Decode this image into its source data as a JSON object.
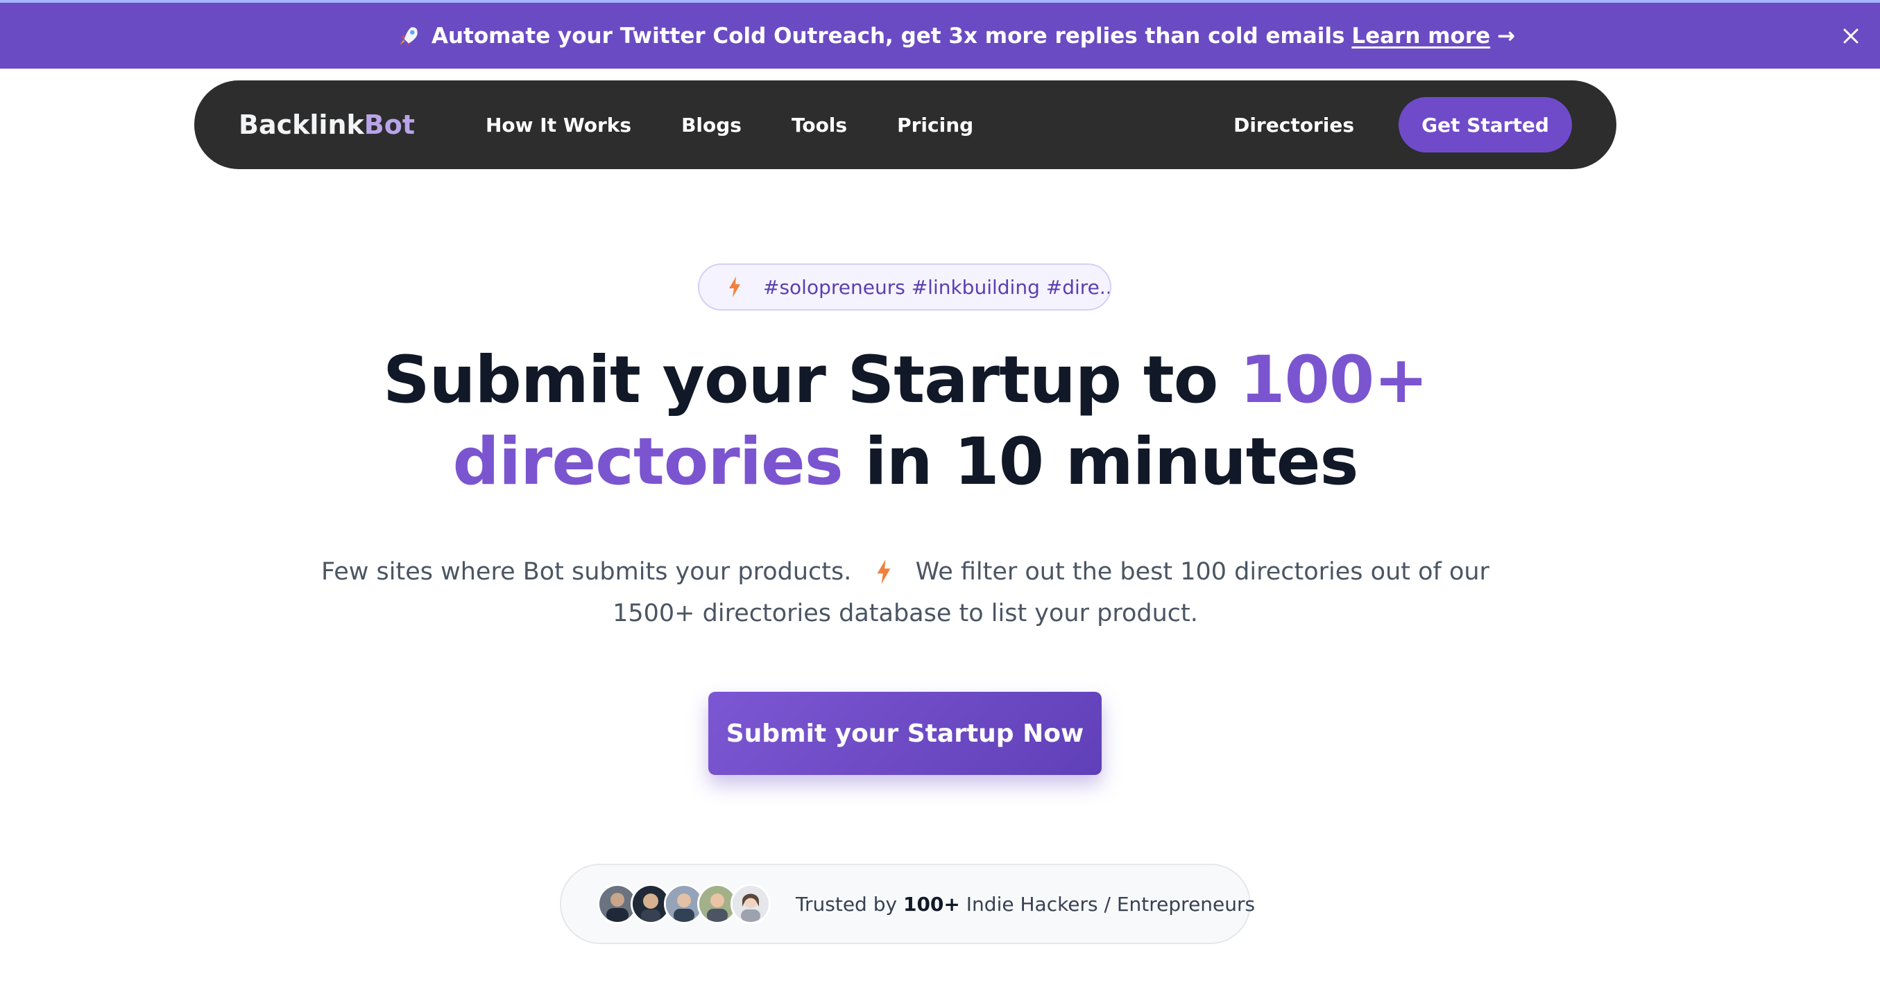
{
  "banner": {
    "text": "Automate your Twitter Cold Outreach, get 3x more replies than cold emails",
    "link": "Learn more",
    "arrow": "→",
    "icon": "rocket-icon",
    "close_icon": "close-icon",
    "background": "#6b4bc3"
  },
  "nav": {
    "logo_part1": "Backlink",
    "logo_part2": "Bot",
    "links": [
      "How It Works",
      "Blogs",
      "Tools",
      "Pricing"
    ],
    "directories": "Directories",
    "cta": "Get Started",
    "background": "#2d2d2d"
  },
  "hero": {
    "tag_text": "#solopreneurs #linkbuilding #dire...",
    "tag_icon": "lightning-icon",
    "headline_1": "Submit your Startup to ",
    "headline_accent_1": "100+",
    "headline_accent_2": "directories",
    "headline_2": " in 10 minutes",
    "sub_1": "Few sites where Bot submits your products.",
    "sub_2": "We filter out the best 100 directories out of our 1500+ directories database to list your product.",
    "cta": "Submit your Startup Now",
    "accent_color": "#7b55d0"
  },
  "trusted": {
    "prefix": "Trusted by ",
    "count": "100+",
    "suffix": " Indie Hackers / Entrepreneurs",
    "avatar_count": 5
  }
}
